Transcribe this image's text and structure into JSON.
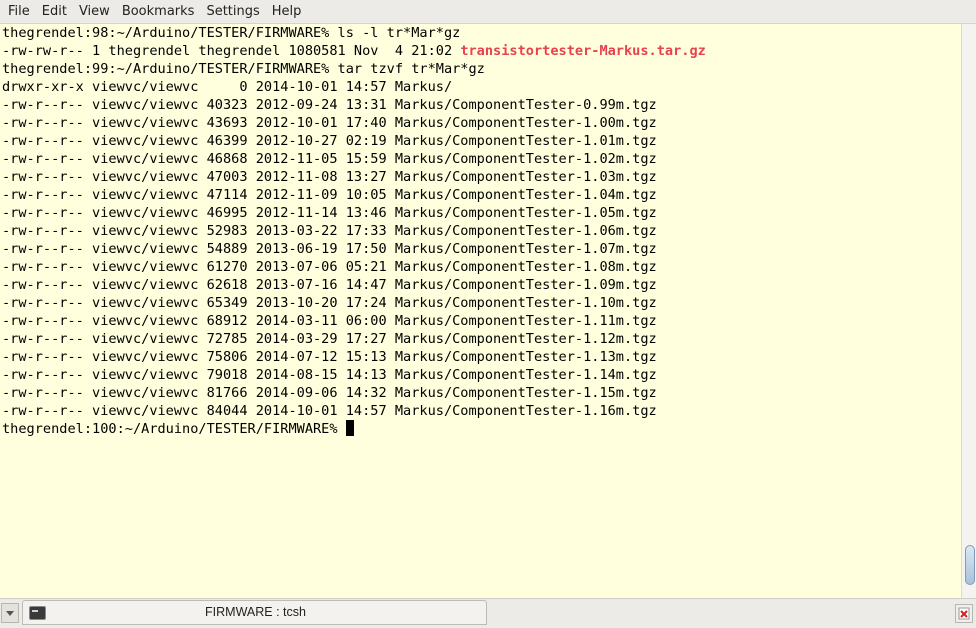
{
  "menubar": {
    "items": [
      "File",
      "Edit",
      "View",
      "Bookmarks",
      "Settings",
      "Help"
    ]
  },
  "terminal": {
    "lines": [
      {
        "text": "thegrendel:98:~/Arduino/TESTER/FIRMWARE% ls -l tr*Mar*gz"
      },
      {
        "text": "-rw-rw-r-- 1 thegrendel thegrendel 1080581 Nov  4 21:02 ",
        "highlight": "transistortester-Markus.tar.gz"
      },
      {
        "text": "thegrendel:99:~/Arduino/TESTER/FIRMWARE% tar tzvf tr*Mar*gz"
      },
      {
        "text": "drwxr-xr-x viewvc/viewvc     0 2014-10-01 14:57 Markus/"
      },
      {
        "text": "-rw-r--r-- viewvc/viewvc 40323 2012-09-24 13:31 Markus/ComponentTester-0.99m.tgz"
      },
      {
        "text": "-rw-r--r-- viewvc/viewvc 43693 2012-10-01 17:40 Markus/ComponentTester-1.00m.tgz"
      },
      {
        "text": "-rw-r--r-- viewvc/viewvc 46399 2012-10-27 02:19 Markus/ComponentTester-1.01m.tgz"
      },
      {
        "text": "-rw-r--r-- viewvc/viewvc 46868 2012-11-05 15:59 Markus/ComponentTester-1.02m.tgz"
      },
      {
        "text": "-rw-r--r-- viewvc/viewvc 47003 2012-11-08 13:27 Markus/ComponentTester-1.03m.tgz"
      },
      {
        "text": "-rw-r--r-- viewvc/viewvc 47114 2012-11-09 10:05 Markus/ComponentTester-1.04m.tgz"
      },
      {
        "text": "-rw-r--r-- viewvc/viewvc 46995 2012-11-14 13:46 Markus/ComponentTester-1.05m.tgz"
      },
      {
        "text": "-rw-r--r-- viewvc/viewvc 52983 2013-03-22 17:33 Markus/ComponentTester-1.06m.tgz"
      },
      {
        "text": "-rw-r--r-- viewvc/viewvc 54889 2013-06-19 17:50 Markus/ComponentTester-1.07m.tgz"
      },
      {
        "text": "-rw-r--r-- viewvc/viewvc 61270 2013-07-06 05:21 Markus/ComponentTester-1.08m.tgz"
      },
      {
        "text": "-rw-r--r-- viewvc/viewvc 62618 2013-07-16 14:47 Markus/ComponentTester-1.09m.tgz"
      },
      {
        "text": "-rw-r--r-- viewvc/viewvc 65349 2013-10-20 17:24 Markus/ComponentTester-1.10m.tgz"
      },
      {
        "text": "-rw-r--r-- viewvc/viewvc 68912 2014-03-11 06:00 Markus/ComponentTester-1.11m.tgz"
      },
      {
        "text": "-rw-r--r-- viewvc/viewvc 72785 2014-03-29 17:27 Markus/ComponentTester-1.12m.tgz"
      },
      {
        "text": "-rw-r--r-- viewvc/viewvc 75806 2014-07-12 15:13 Markus/ComponentTester-1.13m.tgz"
      },
      {
        "text": "-rw-r--r-- viewvc/viewvc 79018 2014-08-15 14:13 Markus/ComponentTester-1.14m.tgz"
      },
      {
        "text": "-rw-r--r-- viewvc/viewvc 81766 2014-09-06 14:32 Markus/ComponentTester-1.15m.tgz"
      },
      {
        "text": "-rw-r--r-- viewvc/viewvc 84044 2014-10-01 14:57 Markus/ComponentTester-1.16m.tgz"
      },
      {
        "text": "thegrendel:100:~/Arduino/TESTER/FIRMWARE% ",
        "cursor": true
      }
    ]
  },
  "scrollbar": {
    "position_fraction": 0.98
  },
  "taskbar": {
    "tab_title": "FIRMWARE : tcsh",
    "tab_icon": "terminal-icon",
    "dropdown_icon": "tab-list-dropdown-icon",
    "close_icon": "close-tab-icon"
  },
  "colors": {
    "background": "#ffffdd",
    "text": "#000000",
    "highlight": "#e8414f"
  }
}
